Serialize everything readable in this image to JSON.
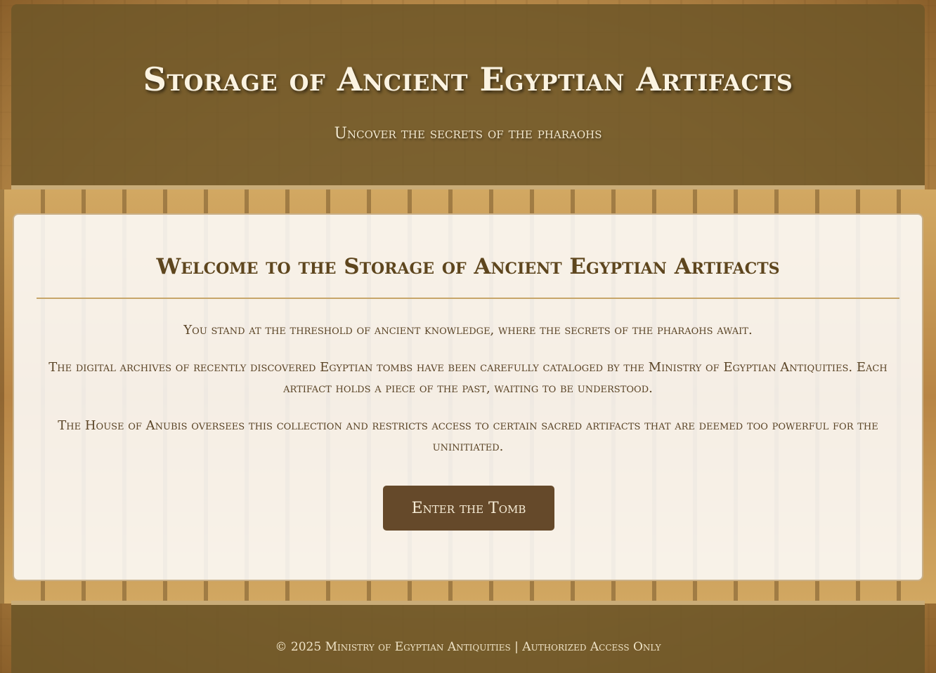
{
  "header": {
    "title": "Storage of Ancient Egyptian Artifacts",
    "subtitle": "Uncover the secrets of the pharaohs"
  },
  "main": {
    "welcome_title": "Welcome to the Storage of Ancient Egyptian Artifacts",
    "paragraphs": [
      "You stand at the threshold of ancient knowledge, where the secrets of the pharaohs await.",
      "The digital archives of recently discovered Egyptian tombs have been carefully cataloged by the Ministry of Egyptian Antiquities. Each artifact holds a piece of the past, waiting to be understood.",
      "The House of Anubis oversees this collection and restricts access to certain sacred artifacts that are deemed too powerful for the uninitiated."
    ],
    "enter_button_label": "Enter the Tomb"
  },
  "footer": {
    "text": "© 2025 Ministry of Egyptian Antiquities | Authorized Access Only"
  },
  "colors": {
    "header_bg": "#6e5628",
    "accent_border": "#c9ac78",
    "button_bg": "#65492a",
    "title_text": "#5e461e",
    "body_text": "#5a4426"
  }
}
